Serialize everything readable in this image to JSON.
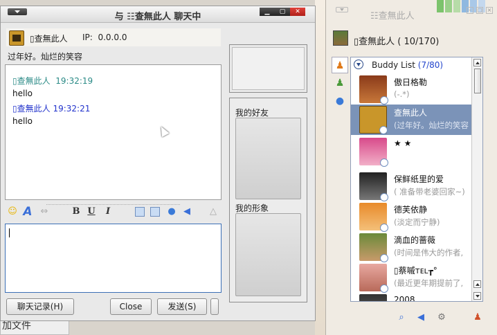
{
  "chat_window": {
    "title": "与 ☷查無此人 聊天中",
    "contact_name": "▯查無此人",
    "ip_label": "IP:",
    "ip_value": "0.0.0.0",
    "status_message": "过年好。灿烂的笑容",
    "messages": [
      {
        "sender": "▯查無此人",
        "time": "19:32:19",
        "text": "hello"
      },
      {
        "sender": "▯查無此人",
        "time": "19:32:21",
        "text": "hello"
      }
    ],
    "buttons": {
      "history": "聊天记录(H)",
      "close": "Close",
      "send": "发送(S)"
    },
    "side": {
      "my_friends": "我的好友",
      "my_image": "我的形象"
    },
    "toolbar_icons": [
      "smiley-icon",
      "font-icon",
      "link-icon",
      "bold-icon",
      "underline-icon",
      "italic-icon",
      "image-icon",
      "screenshot-icon",
      "bubble-icon",
      "speaker-icon",
      "triangle-icon"
    ],
    "toolbar_labels": {
      "bold": "B",
      "underline": "U",
      "italic": "I"
    }
  },
  "buddy_window": {
    "title": "☷查無此人",
    "self_line": "▯查無此人 ( 10/170)",
    "group": {
      "name": "Buddy List",
      "count": "(7/80)"
    },
    "buddies": [
      {
        "name": "傲日格勒",
        "signature": "(-.*)"
      },
      {
        "name": "查無此人",
        "signature": "(过年好。灿烂的笑容"
      },
      {
        "name": "★ ★",
        "signature": ""
      },
      {
        "name": "保鲜纸里的爱",
        "signature": "( 准备带老婆回家~)"
      },
      {
        "name": "德芙依静",
        "signature": "(淡定而宁静)"
      },
      {
        "name": "滴血的蔷薇",
        "signature": "(时间是伟大的作者,"
      },
      {
        "name": "▯蔡嘁ᴛᴇʟ┲°",
        "signature": "(最近更年期提前了,"
      },
      {
        "name": "2008",
        "signature": ""
      }
    ]
  },
  "background": {
    "file_label": "加文件"
  },
  "colors": {
    "selected_row": "#7b93b8",
    "teal_sender": "#2a8a86",
    "blue_sender": "#2233cc",
    "group_count": "#2244cc",
    "close_button": "#d0302a"
  }
}
